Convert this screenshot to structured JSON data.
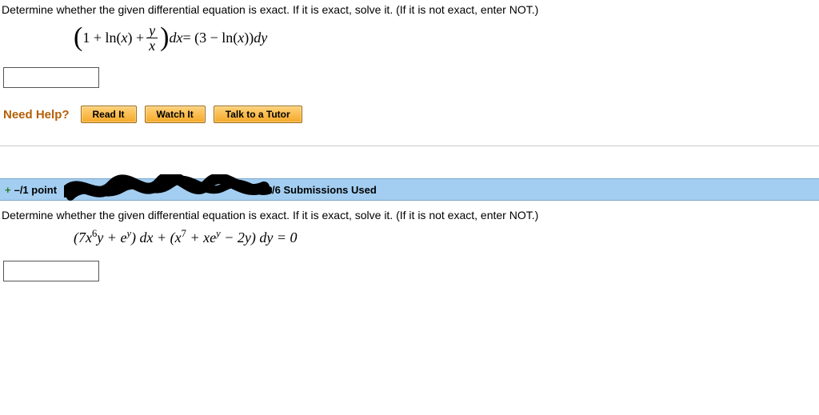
{
  "q1": {
    "prompt": "Determine whether the given differential equation is exact. If it is exact, solve it. (If it is not exact, enter NOT.)",
    "eq_parts": {
      "lp": "(",
      "term1": "1 + ln(",
      "x1": "x",
      "term2": ") + ",
      "frac_num": "y",
      "frac_den": "x",
      "rp": ")",
      "dx": " dx ",
      "eq": "= (3 − ln(",
      "x2": "x",
      "rp2": ")) ",
      "dy": "dy"
    }
  },
  "help": {
    "label": "Need Help?",
    "read": "Read It",
    "watch": "Watch It",
    "tutor": "Talk to a Tutor"
  },
  "bar": {
    "expand": "+",
    "points_prefix": "–/1 point",
    "submissions": "/6 Submissions Used"
  },
  "q2": {
    "prompt": "Determine whether the given differential equation is exact. If it is exact, solve it. (If it is not exact, enter NOT.)",
    "eq": "(7x⁶y + eʸ) dx + (x⁷ + xeʸ − 2y) dy = 0"
  }
}
